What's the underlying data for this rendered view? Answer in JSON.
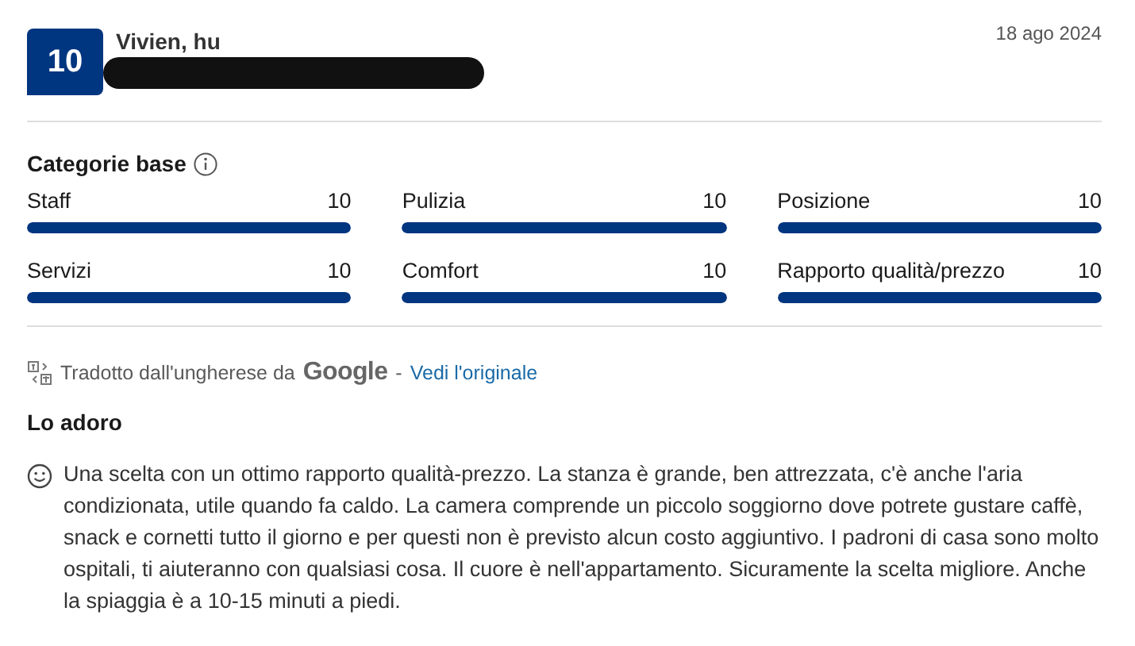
{
  "review": {
    "score": "10",
    "reviewer": "Vivien, hu",
    "date": "18 ago 2024",
    "redacted": true
  },
  "categories": {
    "title": "Categorie base",
    "items": [
      {
        "name": "Staff",
        "score": "10",
        "level": 1
      },
      {
        "name": "Pulizia",
        "score": "10",
        "level": 1
      },
      {
        "name": "Posizione",
        "score": "10",
        "level": 1
      },
      {
        "name": "Servizi",
        "score": "10",
        "level": 1
      },
      {
        "name": "Comfort",
        "score": "10",
        "level": 1
      },
      {
        "name": "Rapporto qualità/prezzo",
        "score": "10",
        "level": 1
      }
    ]
  },
  "translation": {
    "text": "Tradotto dall'ungherese da",
    "brand": "Google",
    "separator": "-",
    "link": "Vedi l'originale"
  },
  "title": "Lo adoro",
  "body": "Una scelta con un ottimo rapporto qualità-prezzo. La stanza è grande, ben attrezzata, c'è anche l'aria condizionata, utile quando fa caldo. La camera comprende un piccolo soggiorno dove potrete gustare caffè, snack e cornetti tutto il giorno e per questi non è previsto alcun costo aggiuntivo. I padroni di casa sono molto ospitali, ti aiuteranno con qualsiasi cosa. Il cuore è nell'appartamento. Sicuramente la scelta migliore. Anche la spiaggia è a 10-15 minuti a piedi."
}
